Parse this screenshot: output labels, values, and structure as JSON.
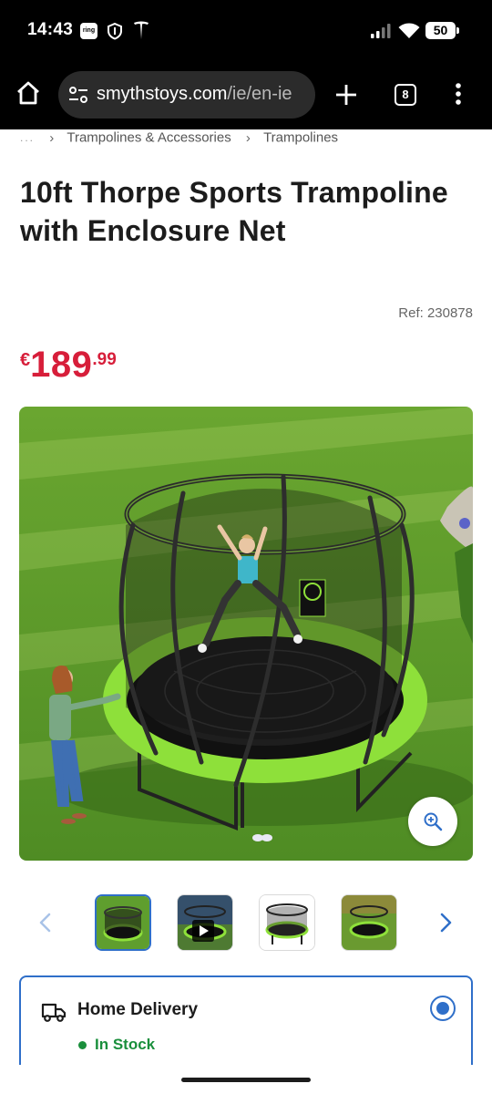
{
  "status_bar": {
    "time": "14:43",
    "ring_label": "ring",
    "battery": "50",
    "icons": [
      "ring-icon",
      "shield-icon",
      "tesla-icon",
      "signal-icon",
      "wifi-icon",
      "battery-icon"
    ]
  },
  "browser": {
    "url_domain": "smythstoys.com",
    "url_path": "/ie/en-ie",
    "tab_count": "8",
    "icons": [
      "home-icon",
      "tune-icon",
      "plus-icon",
      "tabs-icon",
      "menu-icon"
    ]
  },
  "breadcrumb": {
    "ellipsis": "...",
    "items": [
      "Trampolines & Accessories",
      "Trampolines"
    ]
  },
  "product": {
    "title": "10ft Thorpe Sports Trampoline with Enclosure Net",
    "ref": "Ref: 230878",
    "price_currency": "€",
    "price_main": "189",
    "price_cents": ".99"
  },
  "gallery": {
    "thumbnails": 4,
    "active_index": 0,
    "video_thumbnail_index": 1
  },
  "delivery": {
    "title": "Home Delivery",
    "stock": "In Stock",
    "selected": true
  },
  "colors": {
    "price": "#d71e3a",
    "accent": "#2f6fc9",
    "stock": "#1a8f3c",
    "trampoline_pad": "#8ee03a",
    "grass": "#5f9e2e"
  }
}
